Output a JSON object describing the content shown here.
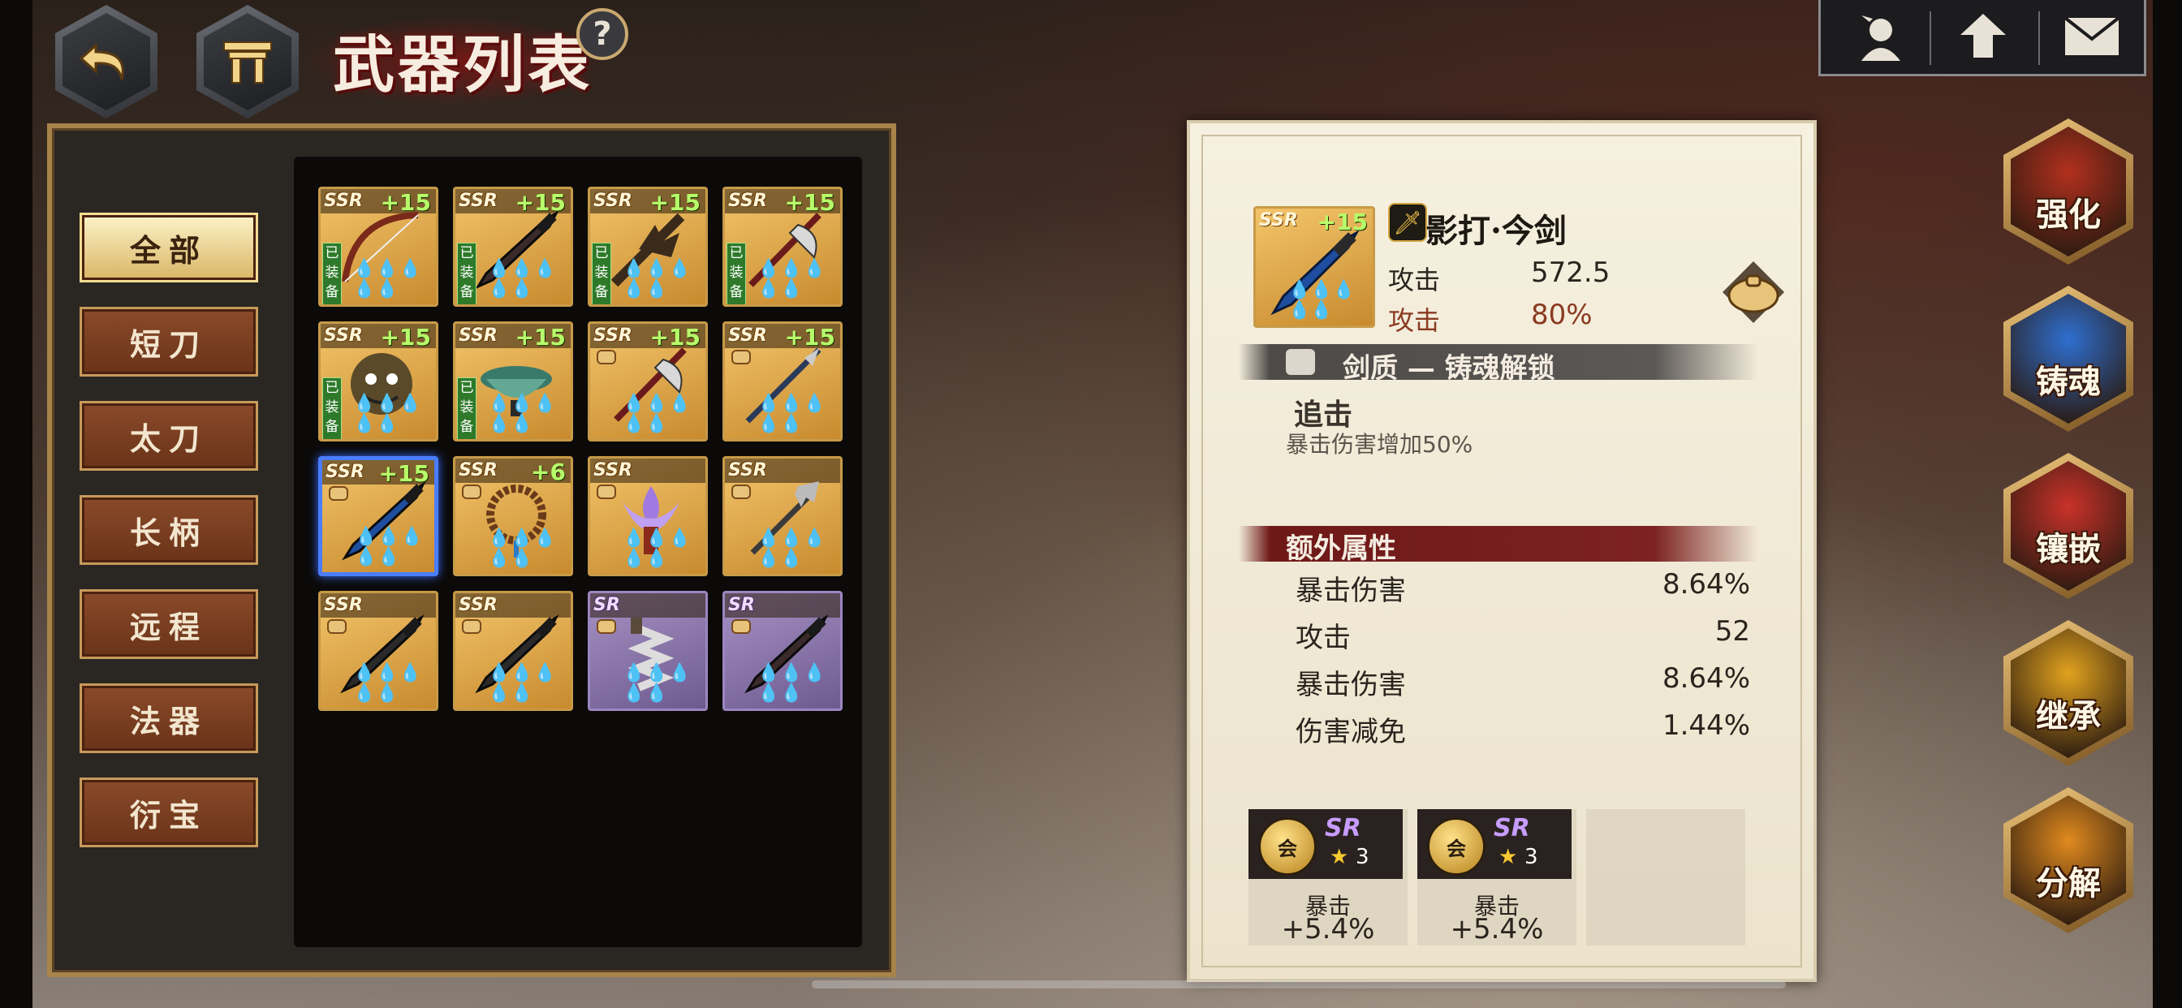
{
  "header": {
    "title": "武器列表",
    "help": "?"
  },
  "categories": [
    {
      "label": "全部",
      "active": true
    },
    {
      "label": "短刀",
      "active": false
    },
    {
      "label": "太刀",
      "active": false
    },
    {
      "label": "长柄",
      "active": false
    },
    {
      "label": "远程",
      "active": false
    },
    {
      "label": "法器",
      "active": false
    },
    {
      "label": "衍宝",
      "active": false
    }
  ],
  "weapons": [
    {
      "rarity": "SSR",
      "level": "+15",
      "equipped": "已装备",
      "kind": "bow",
      "color": "#7a2a1a"
    },
    {
      "rarity": "SSR",
      "level": "+15",
      "equipped": "已装备",
      "kind": "blade",
      "color": "#3a2a2a"
    },
    {
      "rarity": "SSR",
      "level": "+15",
      "equipped": "已装备",
      "kind": "spiked",
      "color": "#3a2a1a"
    },
    {
      "rarity": "SSR",
      "level": "+15",
      "equipped": "已装备",
      "kind": "halberd",
      "color": "#6a1a1a"
    },
    {
      "rarity": "SSR",
      "level": "+15",
      "equipped": "已装备",
      "kind": "mask",
      "color": "#5a4a2a"
    },
    {
      "rarity": "SSR",
      "level": "+15",
      "equipped": "已装备",
      "kind": "bowl",
      "color": "#3a7a6a"
    },
    {
      "rarity": "SSR",
      "level": "+15",
      "equipped": "",
      "kind": "halberd",
      "color": "#6a1a1a"
    },
    {
      "rarity": "SSR",
      "level": "+15",
      "equipped": "",
      "kind": "spear",
      "color": "#2a3a5a"
    },
    {
      "rarity": "SSR",
      "level": "+15",
      "equipped": "",
      "kind": "blade",
      "color": "#1e4e9e",
      "selected": true
    },
    {
      "rarity": "SSR",
      "level": "+6",
      "equipped": "",
      "kind": "beads",
      "color": "#6a3a1a"
    },
    {
      "rarity": "SSR",
      "level": "",
      "equipped": "",
      "kind": "lotus",
      "color": "#a07ae0"
    },
    {
      "rarity": "SSR",
      "level": "",
      "equipped": "",
      "kind": "trident",
      "color": "#3a3a3a"
    },
    {
      "rarity": "SSR",
      "level": "",
      "equipped": "",
      "kind": "blade",
      "color": "#2a2a2a"
    },
    {
      "rarity": "SSR",
      "level": "",
      "equipped": "",
      "kind": "blade",
      "color": "#2a2a2a"
    },
    {
      "rarity": "SR",
      "level": "",
      "equipped": "",
      "kind": "chain",
      "color": "#dddddd"
    },
    {
      "rarity": "SR",
      "level": "",
      "equipped": "",
      "kind": "blade",
      "color": "#3a2a2a"
    }
  ],
  "detail": {
    "rarity": "SSR",
    "level": "+15",
    "name": "影打·今剑",
    "attack_label": "攻击",
    "attack_value": "572.5",
    "attack_bonus_label": "攻击",
    "attack_bonus_value": "80%",
    "section1": "剑质 — 铸魂解锁",
    "skill_name": "追击",
    "skill_desc": "暴击伤害增加50%",
    "section2": "额外属性",
    "attributes": [
      {
        "label": "暴击伤害",
        "value": "8.64%"
      },
      {
        "label": "攻击",
        "value": "52"
      },
      {
        "label": "暴击伤害",
        "value": "8.64%"
      },
      {
        "label": "伤害减免",
        "value": "1.44%"
      }
    ],
    "gems": [
      {
        "rarity": "SR",
        "stars": "3",
        "label": "暴击",
        "value": "+5.4%",
        "coin": "会"
      },
      {
        "rarity": "SR",
        "stars": "3",
        "label": "暴击",
        "value": "+5.4%",
        "coin": "会"
      }
    ]
  },
  "actions": [
    {
      "label": "强化",
      "color": "#b2301e"
    },
    {
      "label": "铸魂",
      "color": "#2f6fd0"
    },
    {
      "label": "镶嵌",
      "color": "#c9322a"
    },
    {
      "label": "继承",
      "color": "#e1a21e"
    },
    {
      "label": "分解",
      "color": "#e08a1e"
    }
  ],
  "colors": {
    "accent_gold": "#c89a48",
    "selected_blue": "#4a7dff",
    "red_brush": "#7c2222",
    "attack_bonus": "#8a3a20"
  },
  "icons": [
    "back-arrow-icon",
    "home-gate-icon",
    "profile-icon",
    "upgrade-arrow-icon",
    "mail-icon"
  ]
}
